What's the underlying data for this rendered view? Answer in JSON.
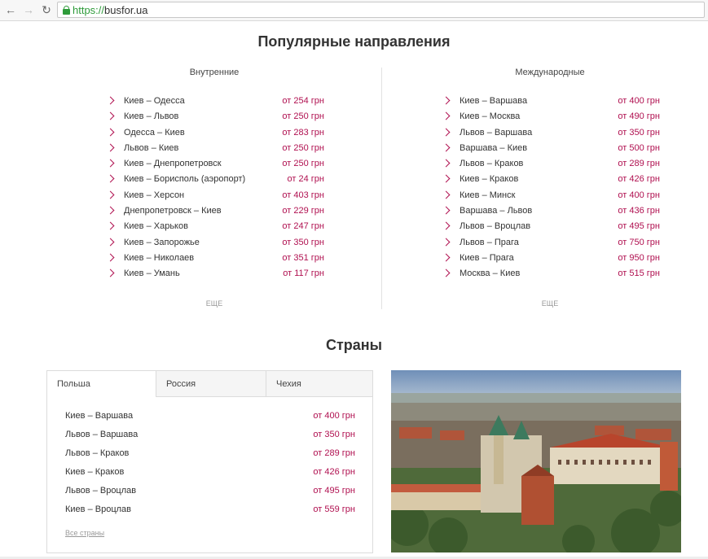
{
  "browser": {
    "url_scheme": "https://",
    "url_host": "busfor.ua"
  },
  "popular": {
    "title": "Популярные направления",
    "domestic": {
      "heading": "Внутренние",
      "more_label": "ЕЩЕ",
      "routes": [
        {
          "name": "Киев – Одесса",
          "price": "от 254 грн"
        },
        {
          "name": "Киев – Львов",
          "price": "от 250 грн"
        },
        {
          "name": "Одесса – Киев",
          "price": "от 283 грн"
        },
        {
          "name": "Львов – Киев",
          "price": "от 250 грн"
        },
        {
          "name": "Киев – Днепропетровск",
          "price": "от 250 грн"
        },
        {
          "name": "Киев – Борисполь (аэропорт)",
          "price": "от 24 грн"
        },
        {
          "name": "Киев – Херсон",
          "price": "от 403 грн"
        },
        {
          "name": "Днепропетровск – Киев",
          "price": "от 229 грн"
        },
        {
          "name": "Киев – Харьков",
          "price": "от 247 грн"
        },
        {
          "name": "Киев – Запорожье",
          "price": "от 350 грн"
        },
        {
          "name": "Киев – Николаев",
          "price": "от 351 грн"
        },
        {
          "name": "Киев – Умань",
          "price": "от 117 грн"
        }
      ]
    },
    "international": {
      "heading": "Международные",
      "more_label": "ЕЩЕ",
      "routes": [
        {
          "name": "Киев – Варшава",
          "price": "от 400 грн"
        },
        {
          "name": "Киев – Москва",
          "price": "от 490 грн"
        },
        {
          "name": "Львов – Варшава",
          "price": "от 350 грн"
        },
        {
          "name": "Варшава – Киев",
          "price": "от 500 грн"
        },
        {
          "name": "Львов – Краков",
          "price": "от 289 грн"
        },
        {
          "name": "Киев – Краков",
          "price": "от 426 грн"
        },
        {
          "name": "Киев – Минск",
          "price": "от 400 грн"
        },
        {
          "name": "Варшава – Львов",
          "price": "от 436 грн"
        },
        {
          "name": "Львов – Вроцлав",
          "price": "от 495 грн"
        },
        {
          "name": "Львов – Прага",
          "price": "от 750 грн"
        },
        {
          "name": "Киев – Прага",
          "price": "от 950 грн"
        },
        {
          "name": "Москва – Киев",
          "price": "от 515 грн"
        }
      ]
    }
  },
  "countries": {
    "title": "Страны",
    "tabs": [
      {
        "label": "Польша",
        "active": true
      },
      {
        "label": "Россия",
        "active": false
      },
      {
        "label": "Чехия",
        "active": false
      }
    ],
    "routes": [
      {
        "name": "Киев – Варшава",
        "price": "от 400 грн"
      },
      {
        "name": "Львов – Варшава",
        "price": "от 350 грн"
      },
      {
        "name": "Львов – Краков",
        "price": "от 289 грн"
      },
      {
        "name": "Киев – Краков",
        "price": "от 426 грн"
      },
      {
        "name": "Львов – Вроцлав",
        "price": "от 495 грн"
      },
      {
        "name": "Киев – Вроцлав",
        "price": "от 559 грн"
      }
    ],
    "all_link": "Все страны"
  },
  "colors": {
    "price": "#b01050",
    "secure": "#2e9b3a"
  }
}
